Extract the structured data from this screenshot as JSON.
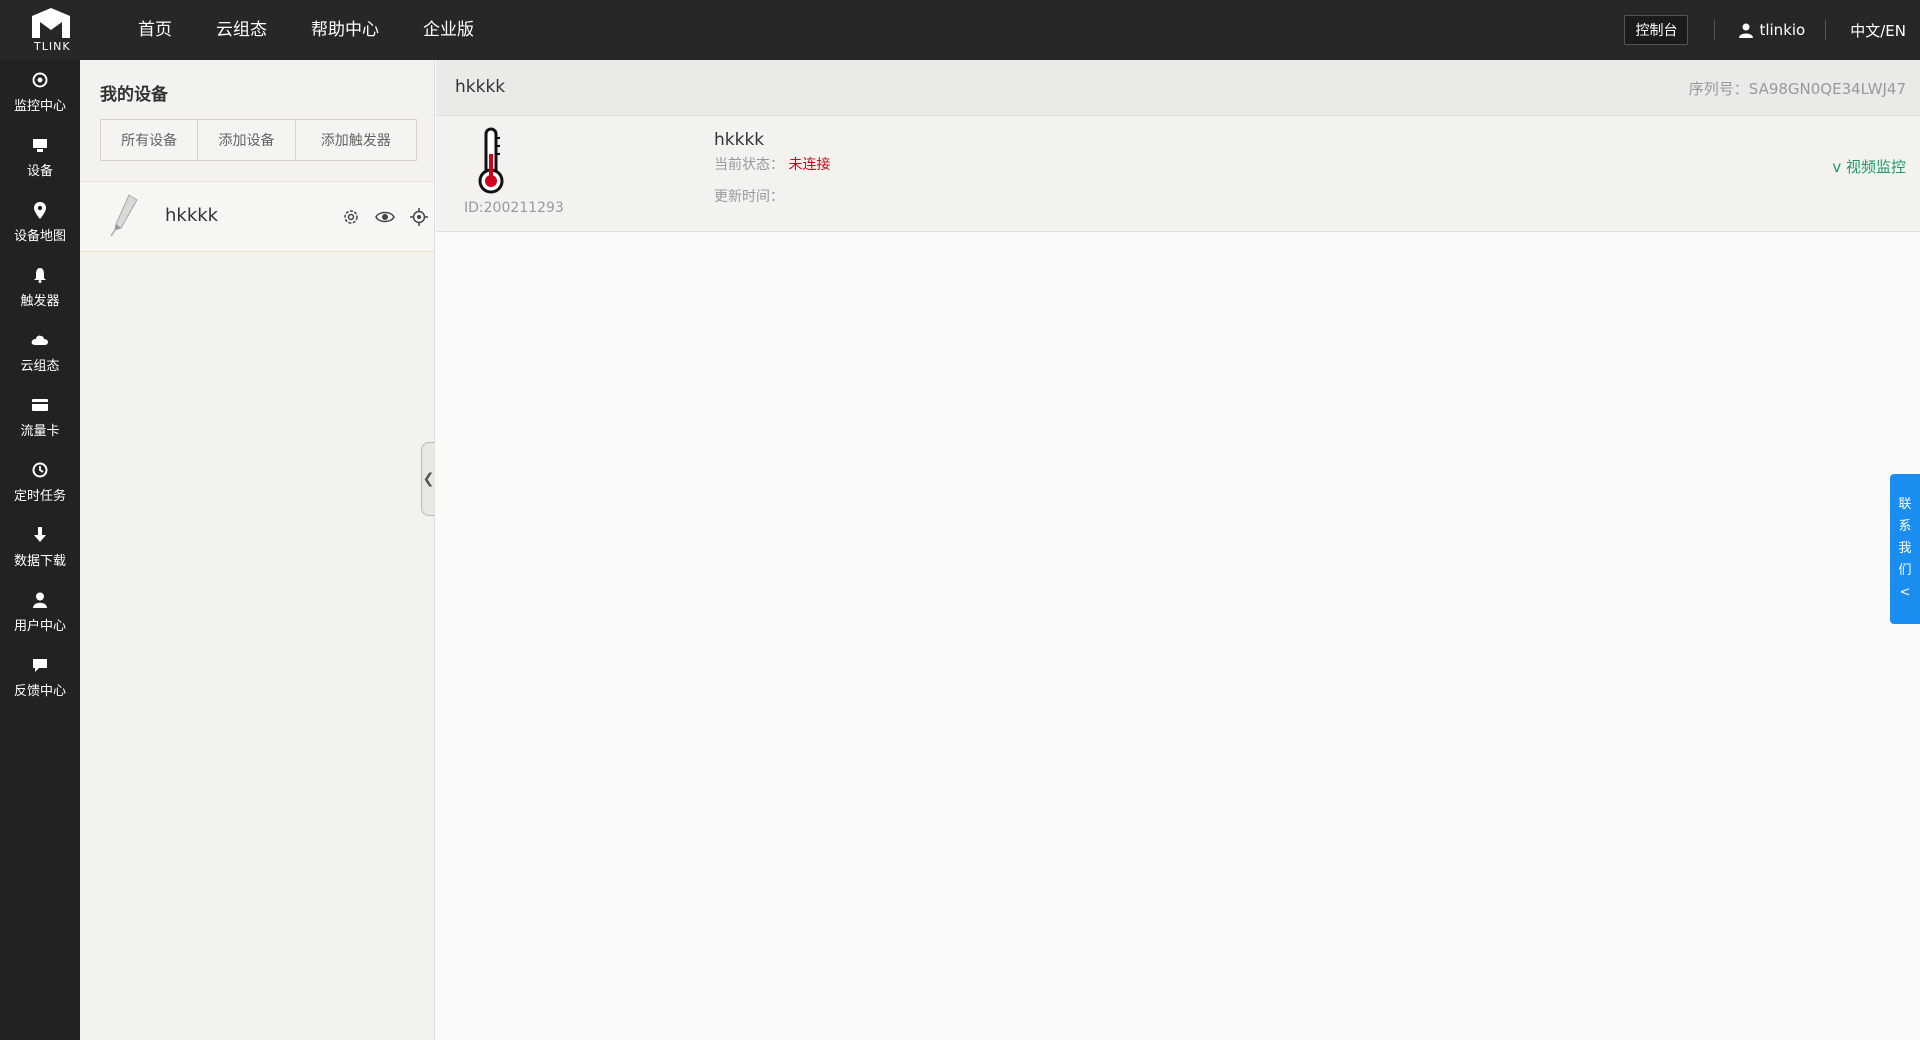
{
  "topbar": {
    "brand_text": "TLINK",
    "nav": [
      "首页",
      "云组态",
      "帮助中心",
      "企业版"
    ],
    "console_label": "控制台",
    "username": "tlinkio",
    "language": "中文/EN"
  },
  "sidebar": {
    "items": [
      {
        "label": "监控中心",
        "icon": "target-icon"
      },
      {
        "label": "设备",
        "icon": "monitor-icon"
      },
      {
        "label": "设备地图",
        "icon": "map-pin-icon"
      },
      {
        "label": "触发器",
        "icon": "bell-icon"
      },
      {
        "label": "云组态",
        "icon": "cloud-icon"
      },
      {
        "label": "流量卡",
        "icon": "card-icon"
      },
      {
        "label": "定时任务",
        "icon": "clock-icon"
      },
      {
        "label": "数据下载",
        "icon": "download-icon"
      },
      {
        "label": "用户中心",
        "icon": "user-icon"
      },
      {
        "label": "反馈中心",
        "icon": "chat-icon"
      }
    ]
  },
  "devpanel": {
    "title": "我的设备",
    "tabs": [
      "所有设备",
      "添加设备",
      "添加触发器"
    ],
    "devices": [
      {
        "name": "hkkkk",
        "icon": "pen-icon"
      }
    ]
  },
  "main": {
    "title": "hkkkk",
    "serial": "序列号：SA98GN0QE34LWJ47",
    "device": {
      "id": "ID:200211293",
      "name": "hkkkk",
      "status_label": "当前状态：",
      "status_value": "未连接",
      "update_label": "更新时间：",
      "video_link": "v 视频监控",
      "icon": "thermometer-icon"
    }
  },
  "contact": {
    "chars": [
      "联",
      "系",
      "我",
      "们",
      "<"
    ]
  },
  "colors": {
    "topbar": "#272727",
    "sidebar": "#222222",
    "status_offline": "#d0021b",
    "video_link": "#1e9a6a",
    "contact_bg": "#1a8ef0"
  }
}
